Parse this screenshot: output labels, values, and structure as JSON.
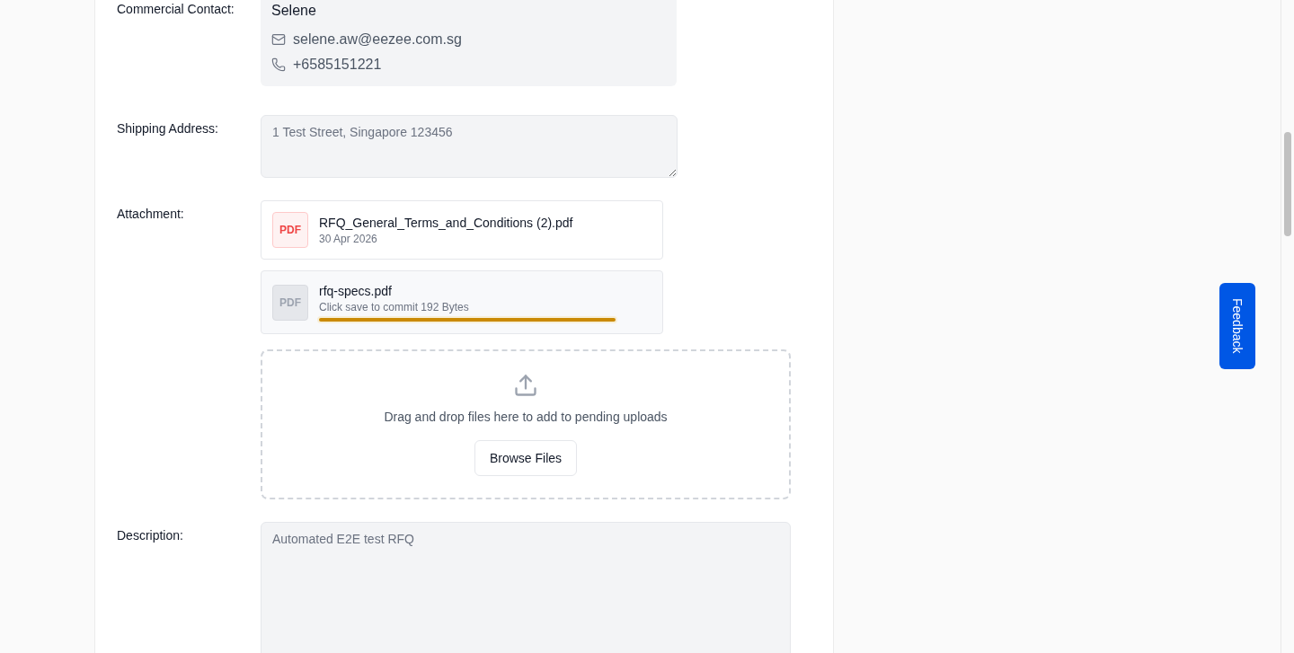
{
  "form": {
    "rows": [
      {
        "kind": "contact",
        "label": "Commercial Contact:",
        "name": "Selene",
        "email": "selene.aw@eezee.com.sg",
        "phone": "+6585151221"
      },
      {
        "kind": "address",
        "label": "Shipping Address:",
        "value": "1 Test Street, Singapore 123456",
        "disabled": true
      },
      {
        "kind": "attachments",
        "label": "Attachment:",
        "files": [
          {
            "kind": "saved",
            "badge": "PDF",
            "name": "RFQ_General_Terms_and_Conditions (2).pdf",
            "meta": "30 Apr 2026"
          },
          {
            "kind": "pending",
            "badge": "PDF",
            "name": "rfq-specs.pdf",
            "meta": "Click save to commit 192 Bytes",
            "level": 1
          }
        ],
        "dropzone": {
          "text": "Drag and drop files here to add to pending uploads",
          "button": "Browse Files"
        }
      },
      {
        "kind": "description",
        "label": "Description:",
        "value": "Automated E2E test RFQ",
        "disabled": true
      }
    ]
  },
  "feedback": {
    "label": "Feedback"
  }
}
